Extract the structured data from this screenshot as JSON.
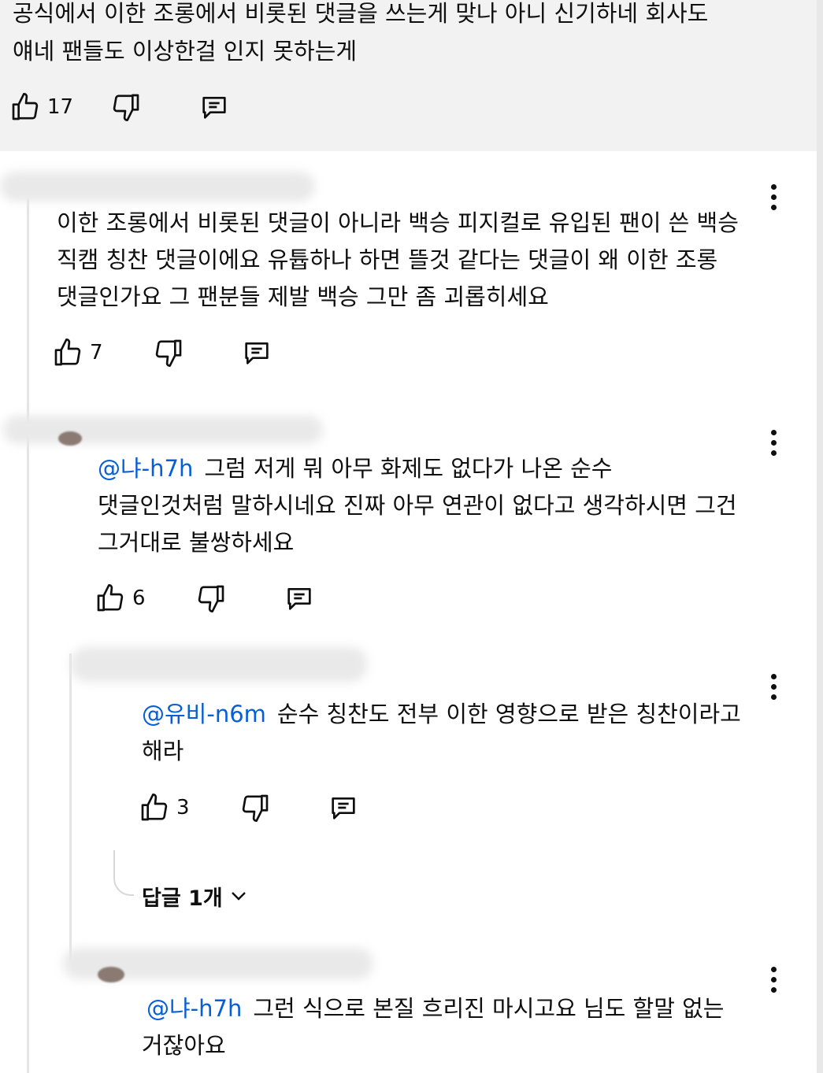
{
  "comments": [
    {
      "lines": [
        "공식에서 이한 조롱에서 비롯된 댓글을 쓰는게 맞나 아니 신기하네 회사도",
        "얘네 팬들도 이상한걸 인지 못하는게"
      ],
      "likes": "17"
    },
    {
      "lines": [
        "이한 조롱에서 비롯된 댓글이 아니라 백승 피지컬로 유입된 팬이 쓴 백승",
        "직캠 칭찬 댓글이에요  유튭하나 하면 뜰것 같다는 댓글이 왜 이한 조롱",
        "댓글인가요 그 팬분들 제발 백승 그만 좀 괴롭히세요"
      ],
      "likes": "7"
    },
    {
      "mention": "@냐-h7h",
      "lines": [
        "그럼 저게 뭐 아무 화제도 없다가 나온 순수",
        "댓글인것처럼 말하시네요 진짜 아무 연관이 없다고 생각하시면 그건",
        "그거대로 불쌍하세요"
      ],
      "likes": "6"
    },
    {
      "mention": "@유비-n6m",
      "lines": [
        "순수 칭찬도 전부 이한 영향으로 받은 칭찬이라고",
        "해라"
      ],
      "likes": "3",
      "replies_label": "답글 1개"
    },
    {
      "mention": "@냐-h7h",
      "lines": [
        "그런 식으로 본질 흐리진 마시고요 님도 할말 없는",
        "거잖아요"
      ]
    }
  ],
  "icons": {
    "like": "thumbs-up-icon",
    "dislike": "thumbs-down-icon",
    "reply": "reply-comment-icon",
    "more": "more-vert-icon",
    "expand": "chevron-down-icon"
  },
  "colors": {
    "mention": "#065fd4",
    "highlight_bg": "#f2f2f2"
  }
}
